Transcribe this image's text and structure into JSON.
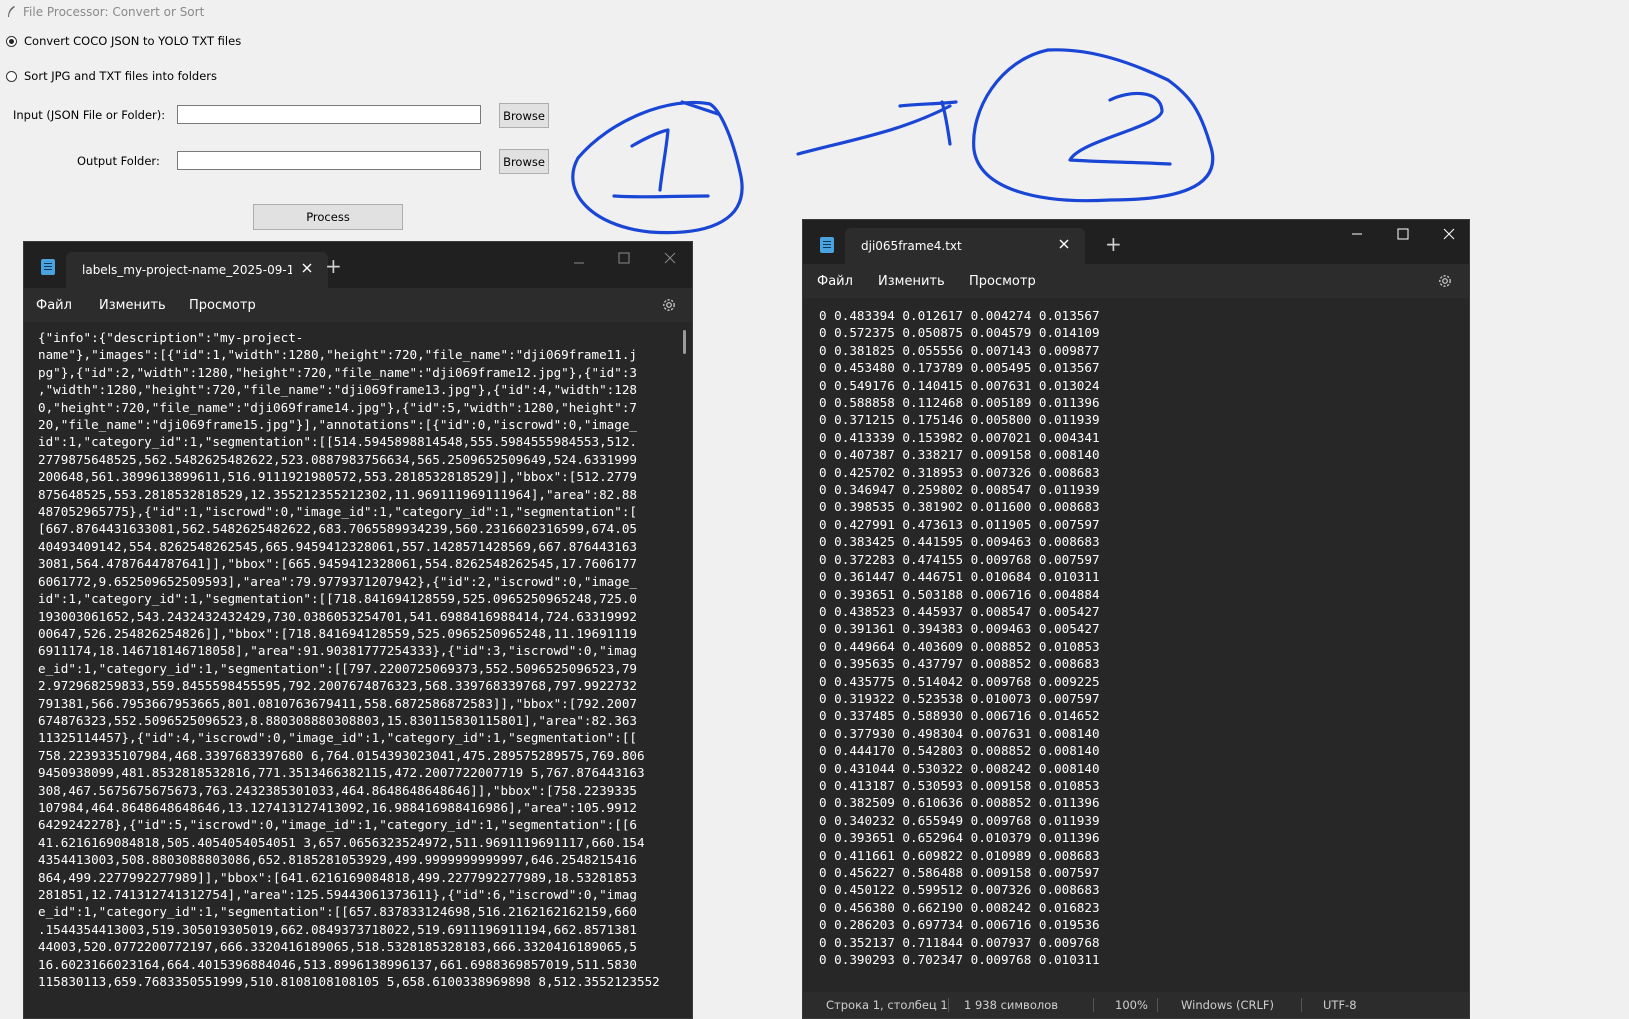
{
  "tk_app": {
    "title": "File Processor: Convert or Sort",
    "radio_convert": "Convert COCO JSON to YOLO TXT files",
    "radio_sort": "Sort JPG and TXT files into folders",
    "selected": "convert",
    "input_label": "Input (JSON File or Folder):",
    "output_label": "Output Folder:",
    "input_value": "",
    "output_value": "",
    "browse_label": "Browse",
    "process_label": "Process"
  },
  "annotation": {
    "step1": "1",
    "step2": "2",
    "color": "#1a46d6"
  },
  "notepad_left": {
    "tab_title": "labels_my-project-name_2025-09-1",
    "menu": [
      "Файл",
      "Изменить",
      "Просмотр"
    ],
    "lines": [
      "{\"info\":{\"description\":\"my-project-",
      "name\"},\"images\":[{\"id\":1,\"width\":1280,\"height\":720,\"file_name\":\"dji069frame11.j",
      "pg\"},{\"id\":2,\"width\":1280,\"height\":720,\"file_name\":\"dji069frame12.jpg\"},{\"id\":3",
      ",\"width\":1280,\"height\":720,\"file_name\":\"dji069frame13.jpg\"},{\"id\":4,\"width\":128",
      "0,\"height\":720,\"file_name\":\"dji069frame14.jpg\"},{\"id\":5,\"width\":1280,\"height\":7",
      "20,\"file_name\":\"dji069frame15.jpg\"}],\"annotations\":[{\"id\":0,\"iscrowd\":0,\"image_",
      "id\":1,\"category_id\":1,\"segmentation\":[[514.5945898814548,555.5984555984553,512.",
      "2779875648525,562.5482625482622,523.0887983756634,565.2509652509649,524.6331999",
      "200648,561.3899613899611,516.9111921980572,553.2818532818529]],\"bbox\":[512.2779",
      "875648525,553.2818532818529,12.355212355212302,11.969111969111964],\"area\":82.88",
      "487052965775},{\"id\":1,\"iscrowd\":0,\"image_id\":1,\"category_id\":1,\"segmentation\":[",
      "[667.8764431633081,562.5482625482622,683.7065589934239,560.2316602316599,674.05",
      "40493409142,554.8262548262545,665.9459412328061,557.1428571428569,667.876443163",
      "3081,564.4787644787641]],\"bbox\":[665.9459412328061,554.8262548262545,17.7606177",
      "6061772,9.652509652509593],\"area\":79.9779371207942},{\"id\":2,\"iscrowd\":0,\"image_",
      "id\":1,\"category_id\":1,\"segmentation\":[[718.841694128559,525.0965250965248,725.0",
      "193003061652,543.2432432432429,730.0386053254701,541.6988416988414,724.63319992",
      "00647,526.254826254826]],\"bbox\":[718.841694128559,525.0965250965248,11.19691119",
      "6911174,18.146718146718058],\"area\":91.90381777254333},{\"id\":3,\"iscrowd\":0,\"imag",
      "e_id\":1,\"category_id\":1,\"segmentation\":[[797.2200725069373,552.5096525096523,79",
      "2.972968259833,559.8455598455595,792.2007674876323,568.339768339768,797.9922732",
      "791381,566.7953667953665,801.0810763679411,558.6872586872583]],\"bbox\":[792.2007",
      "674876323,552.5096525096523,8.880308880308803,15.830115830115801],\"area\":82.363",
      "11325114457},{\"id\":4,\"iscrowd\":0,\"image_id\":1,\"category_id\":1,\"segmentation\":[[",
      "758.2239335107984,468.3397683397680 6,764.0154393023041,475.289575289575,769.806",
      "9450938099,481.8532818532816,771.3513466382115,472.2007722007719 5,767.876443163",
      "308,467.5675675675673,763.2432385301033,464.8648648648646]],\"bbox\":[758.2239335",
      "107984,464.8648648648646,13.127413127413092,16.988416988416986],\"area\":105.9912",
      "6429242278},{\"id\":5,\"iscrowd\":0,\"image_id\":1,\"category_id\":1,\"segmentation\":[[6",
      "41.6216169084818,505.4054054054051 3,657.0656323524972,511.9691119691117,660.154",
      "4354413003,508.8803088803086,652.8185281053929,499.9999999999997,646.2548215416",
      "864,499.2277992277989]],\"bbox\":[641.6216169084818,499.2277992277989,18.53281853",
      "281851,12.741312741312754],\"area\":125.59443061373611},{\"id\":6,\"iscrowd\":0,\"imag",
      "e_id\":1,\"category_id\":1,\"segmentation\":[[657.837833124698,516.2162162162159,660",
      ".1544354413003,519.305019305019,662.0849373718022,519.6911196911194,662.8571381",
      "44003,520.0772200772197,666.3320416189065,518.5328185328183,666.3320416189065,5",
      "16.6023166023164,664.4015396884046,513.8996138996137,661.6988369857019,511.5830",
      "115830113,659.7683350551999,510.8108108108105 5,658.6100338969898 8,512.3552123552"
    ]
  },
  "notepad_right": {
    "tab_title": "dji065frame4.txt",
    "menu": [
      "Файл",
      "Изменить",
      "Просмотр"
    ],
    "lines": [
      "0 0.483394 0.012617 0.004274 0.013567",
      "0 0.572375 0.050875 0.004579 0.014109",
      "0 0.381825 0.055556 0.007143 0.009877",
      "0 0.453480 0.173789 0.005495 0.013567",
      "0 0.549176 0.140415 0.007631 0.013024",
      "0 0.588858 0.112468 0.005189 0.011396",
      "0 0.371215 0.175146 0.005800 0.011939",
      "0 0.413339 0.153982 0.007021 0.004341",
      "0 0.407387 0.338217 0.009158 0.008140",
      "0 0.425702 0.318953 0.007326 0.008683",
      "0 0.346947 0.259802 0.008547 0.011939",
      "0 0.398535 0.381902 0.011600 0.008683",
      "0 0.427991 0.473613 0.011905 0.007597",
      "0 0.383425 0.441595 0.009463 0.008683",
      "0 0.372283 0.474155 0.009768 0.007597",
      "0 0.361447 0.446751 0.010684 0.010311",
      "0 0.393651 0.503188 0.006716 0.004884",
      "0 0.438523 0.445937 0.008547 0.005427",
      "0 0.391361 0.394383 0.009463 0.005427",
      "0 0.449664 0.403609 0.008852 0.010853",
      "0 0.395635 0.437797 0.008852 0.008683",
      "0 0.435775 0.514042 0.009768 0.009225",
      "0 0.319322 0.523538 0.010073 0.007597",
      "0 0.337485 0.588930 0.006716 0.014652",
      "0 0.377930 0.498304 0.007631 0.008140",
      "0 0.444170 0.542803 0.008852 0.008140",
      "0 0.431044 0.530322 0.008242 0.008140",
      "0 0.413187 0.530593 0.009158 0.010853",
      "0 0.382509 0.610636 0.008852 0.011396",
      "0 0.340232 0.655949 0.009768 0.011939",
      "0 0.393651 0.652964 0.010379 0.011396",
      "0 0.411661 0.609822 0.010989 0.008683",
      "0 0.456227 0.586488 0.009158 0.007597",
      "0 0.450122 0.599512 0.007326 0.008683",
      "0 0.456380 0.662190 0.008242 0.016823",
      "0 0.286203 0.697734 0.006716 0.019536",
      "0 0.352137 0.711844 0.007937 0.009768",
      "0 0.390293 0.702347 0.009768 0.010311"
    ],
    "status": {
      "position": "Строка 1, столбец 1",
      "chars": "1 938 символов",
      "zoom": "100%",
      "eol": "Windows (CRLF)",
      "encoding": "UTF-8"
    }
  }
}
